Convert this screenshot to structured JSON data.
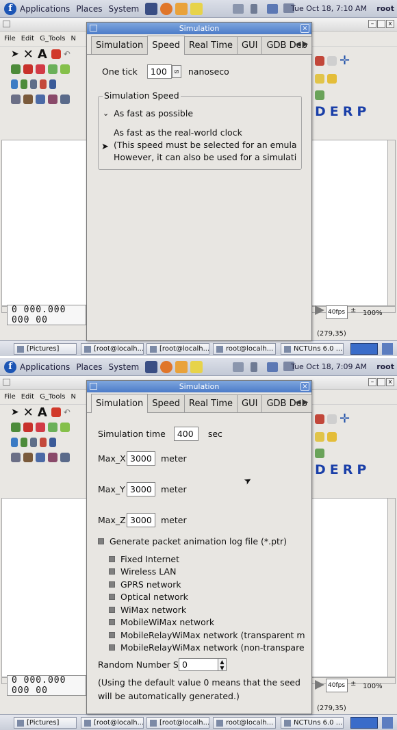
{
  "panel": {
    "menus": [
      "Applications",
      "Places",
      "System"
    ],
    "user": "root"
  },
  "editor": {
    "menu": [
      "File",
      "Edit",
      "G_Tools",
      "N"
    ],
    "letters": "DERP",
    "time_readout": "0 000.000 000 00",
    "fps": "40fps",
    "zoom": "100%",
    "coords": "(279,35)"
  },
  "taskbar": {
    "items": [
      "[Pictures]",
      "[root@localh...",
      "[root@localh...",
      "root@localh...",
      "NCTUns 6.0 ..."
    ]
  },
  "dialog": {
    "title": "Simulation",
    "tabs": [
      "Simulation",
      "Speed",
      "Real Time",
      "GUI",
      "GDB Deb"
    ]
  },
  "shot_a": {
    "clock": "Tue Oct 18, 7:10 AM",
    "active_tab": "Speed",
    "one_tick_label": "One tick",
    "one_tick_value": "100",
    "one_tick_unit": "nanoseco",
    "group_title": "Simulation Speed",
    "option_fast": "As fast as possible",
    "option_realworld": "As fast as the real-world clock",
    "note_line1": "(This speed must be selected for an emula",
    "note_line2": "However, it can also be used for a simulati"
  },
  "shot_b": {
    "clock": "Tue Oct 18, 7:09 AM",
    "active_tab": "Simulation",
    "sim_time_label": "Simulation time",
    "sim_time_value": "400",
    "sim_time_unit": "sec",
    "max_x_label": "Max_X",
    "max_x_value": "3000",
    "max_y_label": "Max_Y",
    "max_y_value": "3000",
    "max_z_label": "Max_Z",
    "max_z_value": "3000",
    "meter": "meter",
    "ptr_label": "Generate packet animation log file (*.ptr)",
    "networks": [
      "Fixed Internet",
      "Wireless LAN",
      "GPRS network",
      "Optical network",
      "WiMax network",
      "MobileWiMax network",
      "MobileRelayWiMax network (transparent m",
      "MobileRelayWiMax network (non-transpare"
    ],
    "random_label": "Random Number S",
    "random_value": "0",
    "seed_note_line1": "(Using the default value 0 means that the seed",
    "seed_note_line2": "will be automatically generated.)"
  },
  "colors": {
    "title_bar": "#4c7bc8",
    "letters": "#1a3fa8"
  }
}
